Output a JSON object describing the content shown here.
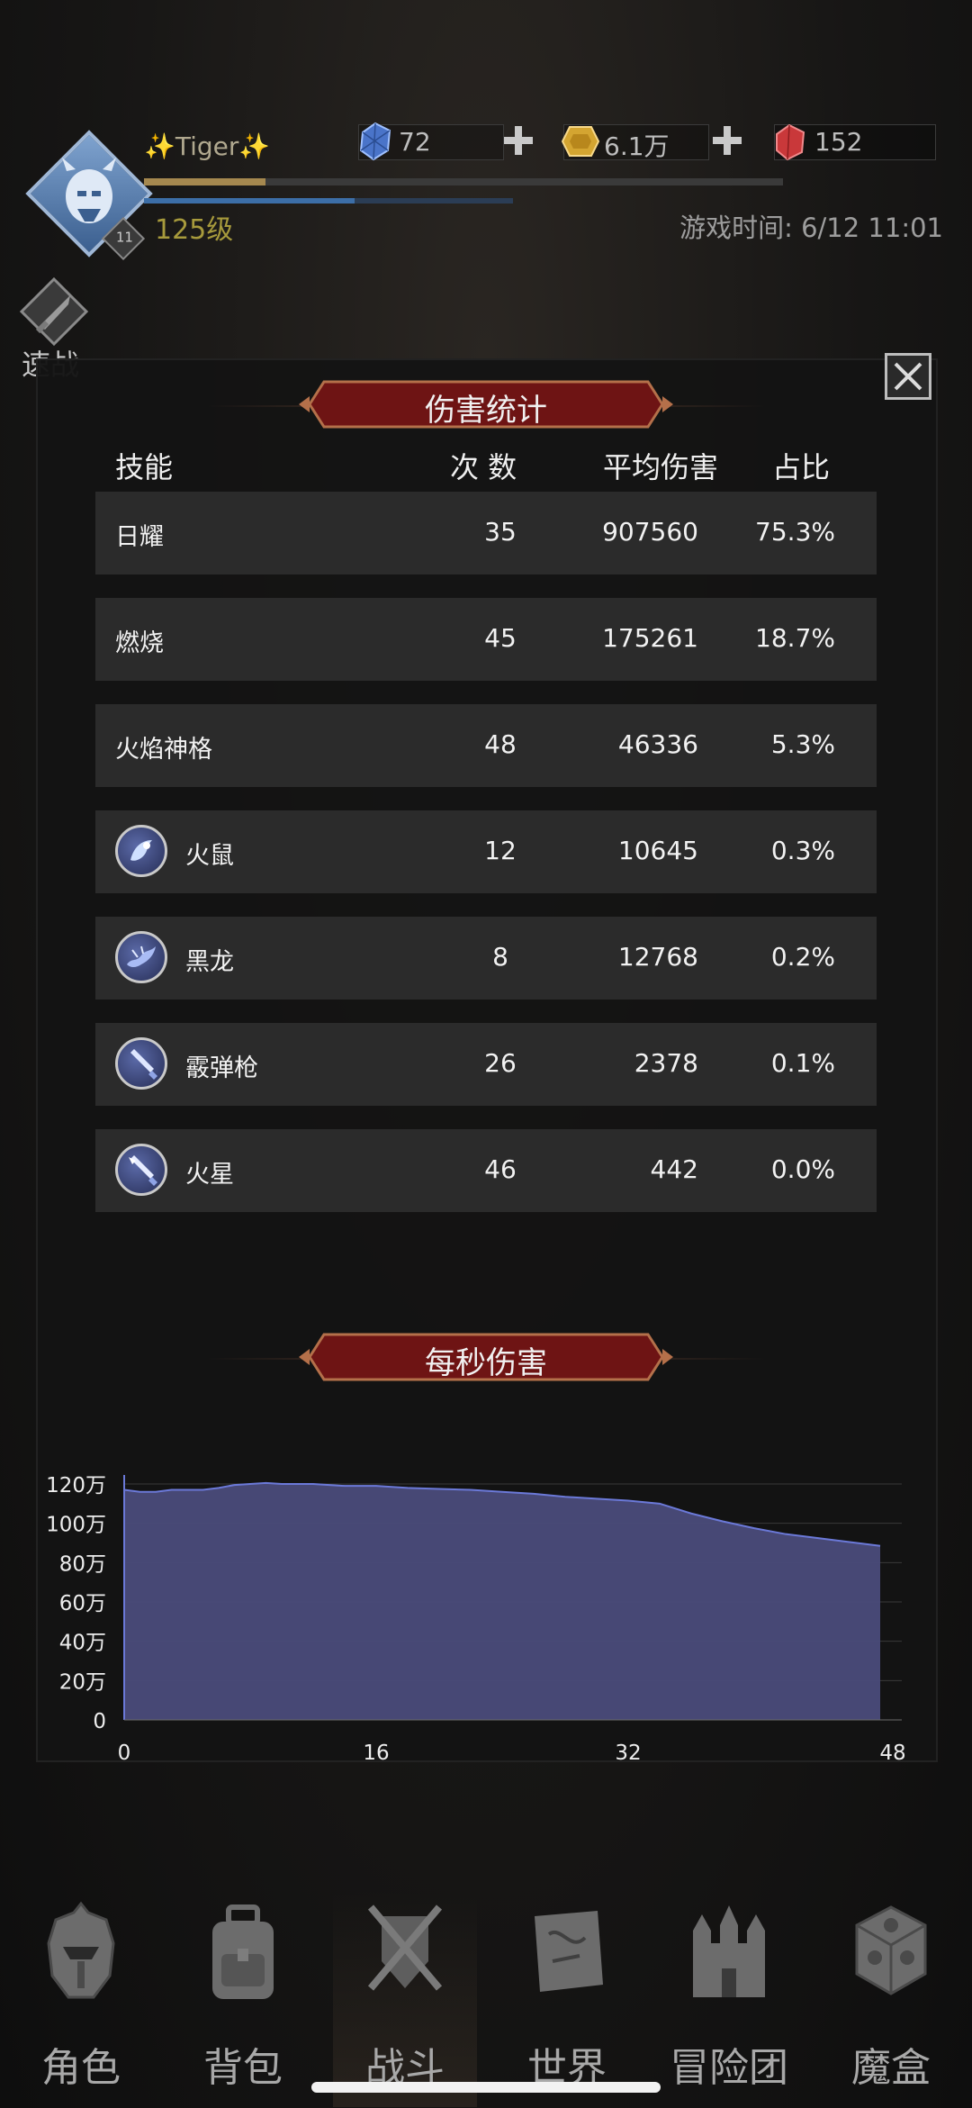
{
  "player": {
    "name": "✨Tiger✨",
    "level": "125级",
    "avatar_badge": "11",
    "exp_progress": 0.19,
    "mp_progress": 0.57,
    "game_time": "游戏时间: 6/12 11:01"
  },
  "currencies": [
    {
      "icon": "blue-gem-icon",
      "value": "72",
      "color": "#4a74c9"
    },
    {
      "icon": "gold-gem-icon",
      "value": "6.1万",
      "color": "#d4a531"
    },
    {
      "icon": "red-gem-icon",
      "value": "152",
      "color": "#c9383a"
    }
  ],
  "quick_fight": {
    "label": "速战"
  },
  "damage_stats": {
    "title": "伤害统计",
    "headers": {
      "skill": "技能",
      "count": "次 数",
      "avg": "平均伤害",
      "pct": "占比"
    },
    "rows": [
      {
        "name": "日耀",
        "count": "35",
        "avg": "907560",
        "pct": "75.3%",
        "icon": null
      },
      {
        "name": "燃烧",
        "count": "45",
        "avg": "175261",
        "pct": "18.7%",
        "icon": null
      },
      {
        "name": "火焰神格",
        "count": "48",
        "avg": "46336",
        "pct": "5.3%",
        "icon": null
      },
      {
        "name": "火鼠",
        "count": "12",
        "avg": "10645",
        "pct": "0.3%",
        "icon": "fire-rat-skill-icon"
      },
      {
        "name": "黑龙",
        "count": "8",
        "avg": "12768",
        "pct": "0.2%",
        "icon": "black-dragon-skill-icon"
      },
      {
        "name": "霰弹枪",
        "count": "26",
        "avg": "2378",
        "pct": "0.1%",
        "icon": "shotgun-skill-icon"
      },
      {
        "name": "火星",
        "count": "46",
        "avg": "442",
        "pct": "0.0%",
        "icon": "spark-skill-icon"
      }
    ]
  },
  "dps": {
    "title": "每秒伤害"
  },
  "chart_data": {
    "type": "area",
    "title": "每秒伤害",
    "x": [
      0,
      1,
      2,
      3,
      4,
      5,
      6,
      7,
      8,
      9,
      10,
      11,
      12,
      13,
      14,
      15,
      16,
      18,
      20,
      22,
      24,
      26,
      28,
      30,
      32,
      34,
      36,
      38,
      40,
      42,
      44,
      46,
      48
    ],
    "y": [
      1170000,
      1160000,
      1160000,
      1170000,
      1170000,
      1170000,
      1180000,
      1195000,
      1200000,
      1205000,
      1200000,
      1200000,
      1200000,
      1195000,
      1190000,
      1190000,
      1190000,
      1180000,
      1175000,
      1170000,
      1160000,
      1150000,
      1135000,
      1125000,
      1115000,
      1100000,
      1050000,
      1010000,
      975000,
      945000,
      925000,
      905000,
      885000
    ],
    "xlim": [
      0,
      48
    ],
    "ylim": [
      0,
      1200000
    ],
    "xticks": [
      "0",
      "16",
      "32",
      "48"
    ],
    "yticks": [
      "0",
      "20万",
      "40万",
      "60万",
      "80万",
      "100万",
      "120万"
    ],
    "xlabel": "",
    "ylabel": "",
    "fill_color": "#4a4b7a",
    "line_color": "#6b79d8",
    "grid": true
  },
  "nav": [
    {
      "label": "角色",
      "icon": "helmet-icon"
    },
    {
      "label": "背包",
      "icon": "backpack-icon"
    },
    {
      "label": "战斗",
      "icon": "swords-shield-icon"
    },
    {
      "label": "世界",
      "icon": "map-scroll-icon"
    },
    {
      "label": "冒险团",
      "icon": "castle-icon"
    },
    {
      "label": "魔盒",
      "icon": "magic-cube-icon"
    }
  ]
}
